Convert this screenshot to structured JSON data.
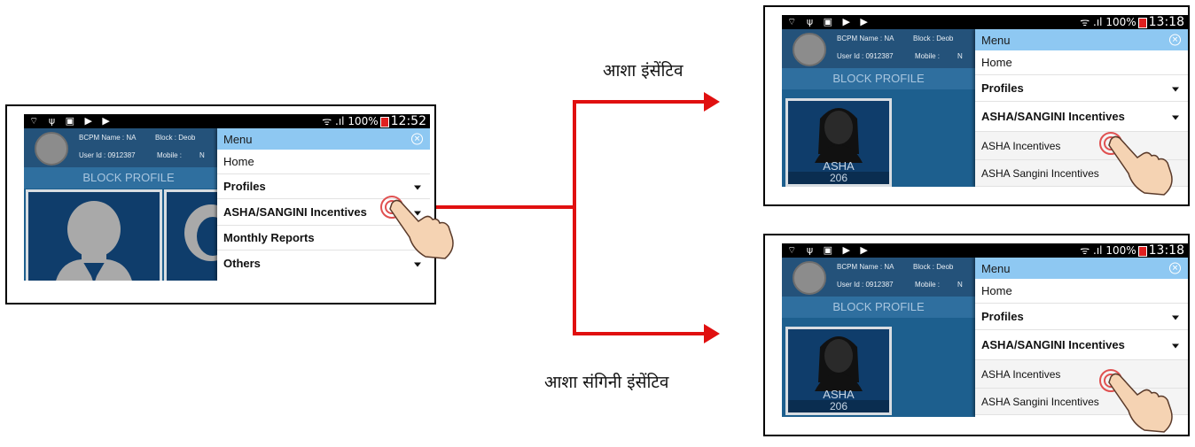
{
  "status": {
    "icons_left": "⌔ ψ ▣ ▶ ▶",
    "signal": "ᯤ .ıl 100%",
    "time_main": "12:52",
    "time_top": "13:18",
    "time_bottom": "13:18"
  },
  "header": {
    "bcpm": "BCPM Name : NA",
    "block": "Block : Deob",
    "user": "User Id : 0912387",
    "mobile": "Mobile :",
    "mobile_cut": "N",
    "block_profile": "BLOCK PROFILE"
  },
  "card": {
    "label": "ASHA",
    "count": "206"
  },
  "menu": {
    "title": "Menu",
    "home": "Home",
    "profiles": "Profiles",
    "incentives": "ASHA/SANGINI Incentives",
    "monthly": "Monthly Reports",
    "others": "Others",
    "asha_incentives": "ASHA Incentives",
    "sangini_incentives": "ASHA Sangini Incentives"
  },
  "labels": {
    "top": "आशा इंसेंटिव",
    "bottom": "आशा संगिनी इंसेंटिव"
  },
  "colors": {
    "arrow": "#e01010",
    "menu_header": "#8ec8f2",
    "app_blue": "#1d5f8e",
    "tap_ring": "#e05050"
  },
  "icons": {
    "close": "close-circle-icon",
    "caret": "caret-down-icon",
    "hand": "tap-hand-icon",
    "avatar": "user-avatar-icon"
  }
}
